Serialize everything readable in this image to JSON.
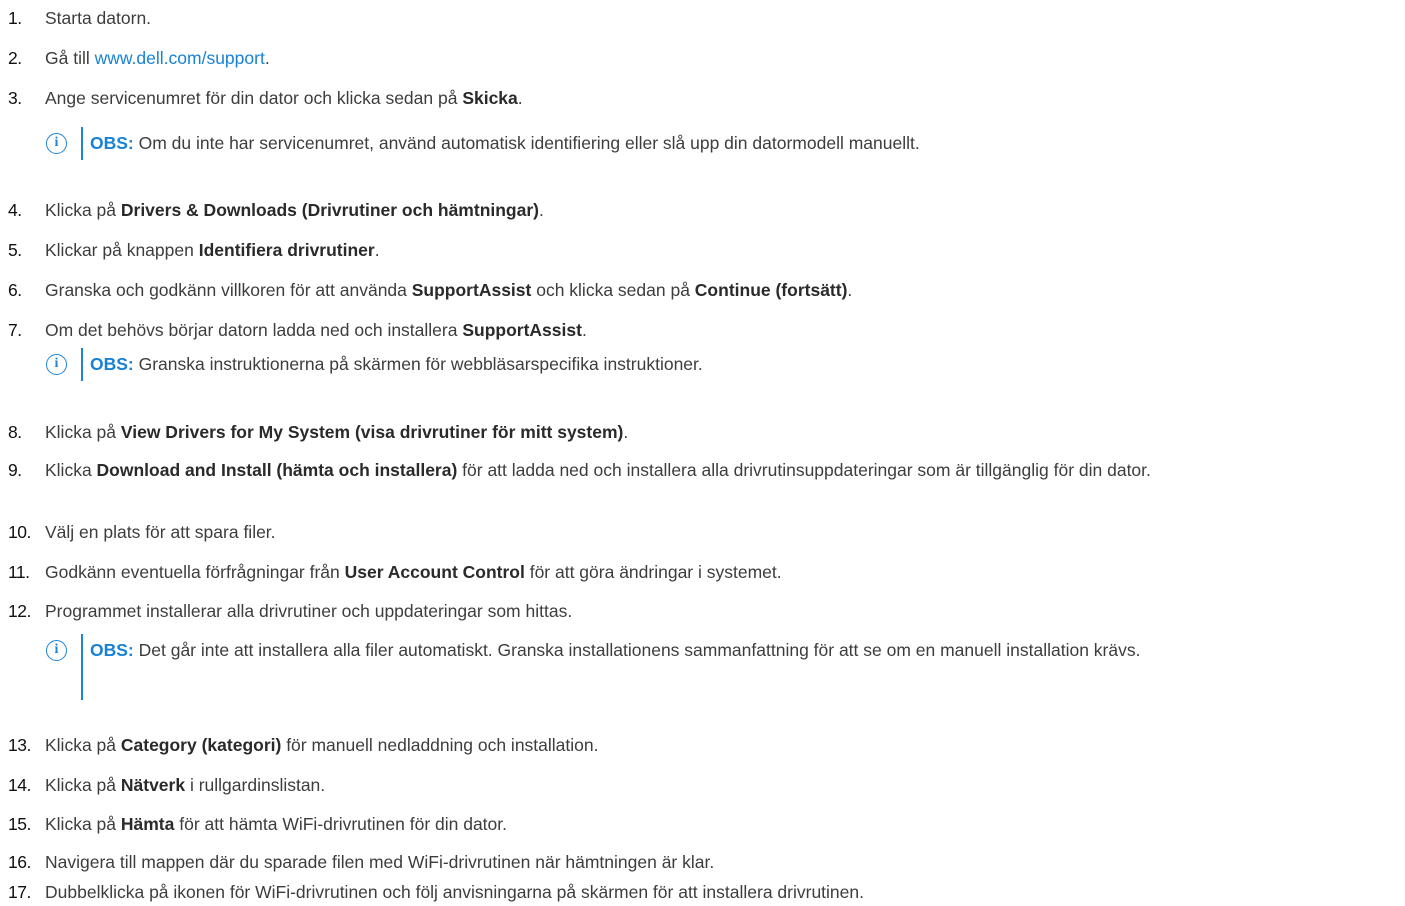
{
  "steps": [
    {
      "n": "1.",
      "parts": [
        {
          "t": "Starta datorn."
        }
      ]
    },
    {
      "n": "2.",
      "parts": [
        {
          "t": "Gå till "
        },
        {
          "t": "www.dell.com/support",
          "link": true
        },
        {
          "t": "."
        }
      ]
    },
    {
      "n": "3.",
      "parts": [
        {
          "t": "Ange servicenumret för din dator och klicka sedan på "
        },
        {
          "t": "Skicka",
          "b": true
        },
        {
          "t": "."
        }
      ]
    },
    {
      "n": "4.",
      "parts": [
        {
          "t": "Klicka på "
        },
        {
          "t": "Drivers & Downloads (Drivrutiner och hämtningar)",
          "b": true
        },
        {
          "t": "."
        }
      ]
    },
    {
      "n": "5.",
      "parts": [
        {
          "t": "Klickar på knappen "
        },
        {
          "t": "Identifiera drivrutiner",
          "b": true
        },
        {
          "t": "."
        }
      ]
    },
    {
      "n": "6.",
      "parts": [
        {
          "t": "Granska och godkänn villkoren för att använda "
        },
        {
          "t": "SupportAssist",
          "b": true
        },
        {
          "t": " och klicka sedan på "
        },
        {
          "t": "Continue (fortsätt)",
          "b": true
        },
        {
          "t": "."
        }
      ]
    },
    {
      "n": "7.",
      "parts": [
        {
          "t": "Om det behövs börjar datorn ladda ned och installera "
        },
        {
          "t": "SupportAssist",
          "b": true
        },
        {
          "t": "."
        }
      ]
    },
    {
      "n": "8.",
      "parts": [
        {
          "t": "Klicka på "
        },
        {
          "t": "View Drivers for My System (visa drivrutiner för mitt system)",
          "b": true
        },
        {
          "t": "."
        }
      ]
    },
    {
      "n": "9.",
      "parts": [
        {
          "t": "Klicka "
        },
        {
          "t": "Download and Install (hämta och installera)",
          "b": true
        },
        {
          "t": " för att ladda ned och installera alla drivrutinsuppdateringar som är tillgänglig för din dator."
        }
      ]
    },
    {
      "n": "10.",
      "parts": [
        {
          "t": "Välj en plats för att spara filer."
        }
      ]
    },
    {
      "n": "11.",
      "parts": [
        {
          "t": "Godkänn eventuella förfrågningar från "
        },
        {
          "t": "User Account Control",
          "b": true
        },
        {
          "t": " för att göra ändringar i systemet."
        }
      ]
    },
    {
      "n": "12.",
      "parts": [
        {
          "t": "Programmet installerar alla drivrutiner och uppdateringar som hittas."
        }
      ]
    },
    {
      "n": "13.",
      "parts": [
        {
          "t": "Klicka på "
        },
        {
          "t": "Category (kategori)",
          "b": true
        },
        {
          "t": " för manuell nedladdning och installation."
        }
      ]
    },
    {
      "n": "14.",
      "parts": [
        {
          "t": "Klicka på "
        },
        {
          "t": "Nätverk",
          "b": true
        },
        {
          "t": " i rullgardinslistan."
        }
      ]
    },
    {
      "n": "15.",
      "parts": [
        {
          "t": "Klicka på "
        },
        {
          "t": "Hämta",
          "b": true
        },
        {
          "t": " för att hämta WiFi-drivrutinen för din dator."
        }
      ]
    },
    {
      "n": "16.",
      "parts": [
        {
          "t": "Navigera till mappen där du sparade filen med WiFi-drivrutinen när hämtningen är klar."
        }
      ]
    },
    {
      "n": "17.",
      "parts": [
        {
          "t": "Dubbelklicka på ikonen för WiFi-drivrutinen och följ anvisningarna på skärmen för att installera drivrutinen."
        }
      ]
    }
  ],
  "notes": [
    {
      "label": "OBS:",
      "text": " Om du inte har servicenumret, använd automatisk identifiering eller slå upp din datormodell manuellt."
    },
    {
      "label": "OBS:",
      "text": " Granska instruktionerna på skärmen för webbläsarspecifika instruktioner."
    },
    {
      "label": "OBS:",
      "text": " Det går inte att installera alla filer automatiskt. Granska installationens sammanfattning för att se om en manuell installation krävs."
    }
  ],
  "note_icon_glyph": "i"
}
